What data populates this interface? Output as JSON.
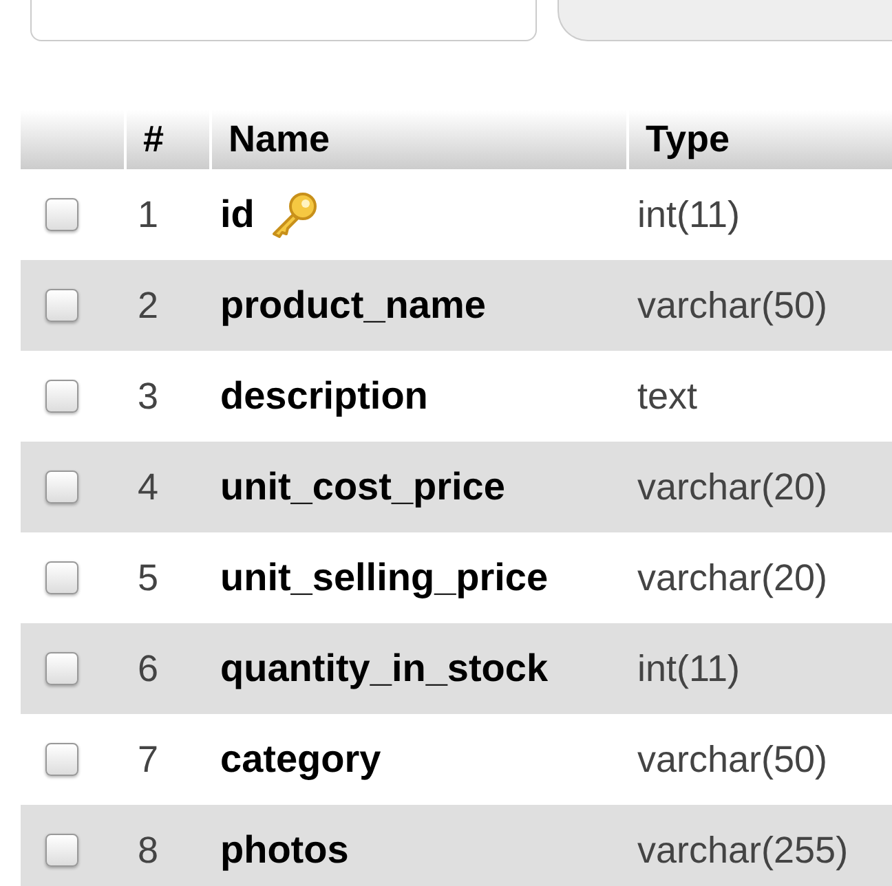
{
  "columns": [
    "#",
    "Name",
    "Type"
  ],
  "rows": [
    {
      "number": "1",
      "name": "id",
      "type": "int(11)",
      "primary_key": true,
      "checked": false
    },
    {
      "number": "2",
      "name": "product_name",
      "type": "varchar(50)",
      "primary_key": false,
      "checked": false
    },
    {
      "number": "3",
      "name": "description",
      "type": "text",
      "primary_key": false,
      "checked": false
    },
    {
      "number": "4",
      "name": "unit_cost_price",
      "type": "varchar(20)",
      "primary_key": false,
      "checked": false
    },
    {
      "number": "5",
      "name": "unit_selling_price",
      "type": "varchar(20)",
      "primary_key": false,
      "checked": false
    },
    {
      "number": "6",
      "name": "quantity_in_stock",
      "type": "int(11)",
      "primary_key": false,
      "checked": false
    },
    {
      "number": "7",
      "name": "category",
      "type": "varchar(50)",
      "primary_key": false,
      "checked": false
    },
    {
      "number": "8",
      "name": "photos",
      "type": "varchar(255)",
      "primary_key": false,
      "checked": false
    }
  ]
}
